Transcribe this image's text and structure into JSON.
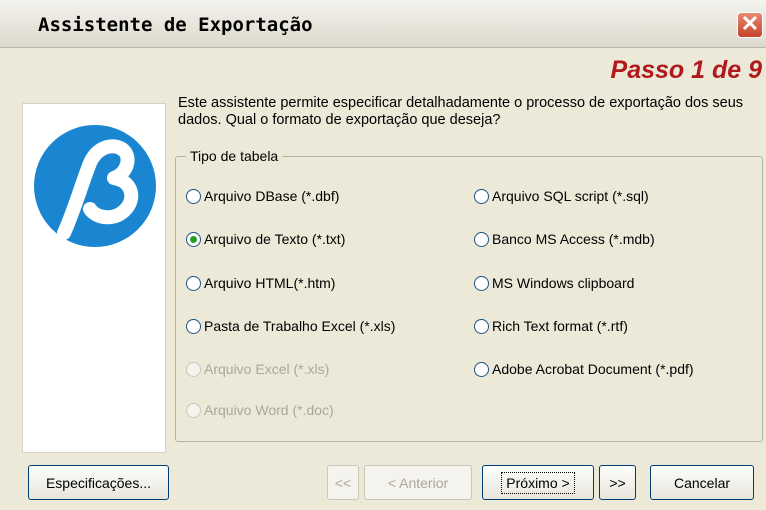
{
  "window": {
    "title": "Assistente de Exportação",
    "close_glyph": "✕"
  },
  "step_label": "Passo 1 de 9",
  "description": "Este assistente permite especificar detalhadamente o processo de exportação dos seus dados. Qual o formato de exportação que deseja?",
  "group": {
    "legend": "Tipo de tabela",
    "left_options": [
      {
        "label": "Arquivo DBase (*.dbf)",
        "selected": false,
        "enabled": true
      },
      {
        "label": "Arquivo de Texto (*.txt)",
        "selected": true,
        "enabled": true
      },
      {
        "label": "Arquivo HTML(*.htm)",
        "selected": false,
        "enabled": true
      },
      {
        "label": "Pasta de Trabalho Excel (*.xls)",
        "selected": false,
        "enabled": true
      },
      {
        "label": "Arquivo Excel (*.xls)",
        "selected": false,
        "enabled": false
      },
      {
        "label": "Arquivo Word (*.doc)",
        "selected": false,
        "enabled": false
      }
    ],
    "right_options": [
      {
        "label": "Arquivo SQL script (*.sql)",
        "selected": false,
        "enabled": true
      },
      {
        "label": "Banco MS Access (*.mdb)",
        "selected": false,
        "enabled": true
      },
      {
        "label": "MS Windows clipboard",
        "selected": false,
        "enabled": true
      },
      {
        "label": "Rich Text format (*.rtf)",
        "selected": false,
        "enabled": true
      },
      {
        "label": "Adobe Acrobat Document (*.pdf)",
        "selected": false,
        "enabled": true
      }
    ]
  },
  "buttons": {
    "specs": "Especificações...",
    "first": "<<",
    "prev": "< Anterior",
    "next": "Próximo >",
    "last": ">>",
    "cancel": "Cancelar"
  },
  "colors": {
    "step_red": "#b2191d",
    "logo_blue": "#1a86d2",
    "radio_green": "#21a121"
  }
}
